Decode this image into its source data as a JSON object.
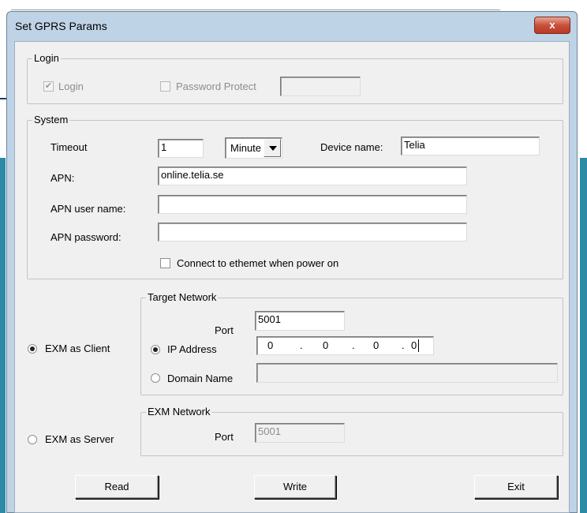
{
  "window": {
    "title": "Set GPRS Params",
    "close_label": "x"
  },
  "login": {
    "group_label": "Login",
    "login_checkbox_label": "Login",
    "login_checked": true,
    "password_protect_label": "Password Protect",
    "password_protect_checked": false,
    "password_value": ""
  },
  "system": {
    "group_label": "System",
    "timeout_label": "Timeout",
    "timeout_value": "1",
    "timeout_unit": "Minute",
    "device_name_label": "Device name:",
    "device_name_value": "Telia",
    "apn_label": "APN:",
    "apn_value": "online.telia.se",
    "apn_user_label": "APN user name:",
    "apn_user_value": "",
    "apn_password_label": "APN password:",
    "apn_password_value": "",
    "ethernet_label": "Connect to ethemet when power on",
    "ethernet_checked": false
  },
  "client": {
    "radio_label": "EXM as Client",
    "selected": true,
    "target_group_label": "Target Network",
    "port_label": "Port",
    "port_value": "5001",
    "ip_radio_label": "IP Address",
    "ip_selected": true,
    "ip_octets": [
      "0",
      "0",
      "0",
      "0"
    ],
    "ip_separator": ".",
    "domain_radio_label": "Domain Name",
    "domain_selected": false,
    "domain_value": ""
  },
  "server": {
    "radio_label": "EXM as Server",
    "selected": false,
    "network_group_label": "EXM Network",
    "port_label": "Port",
    "port_value": "5001"
  },
  "buttons": {
    "read": "Read",
    "write": "Write",
    "exit": "Exit"
  }
}
